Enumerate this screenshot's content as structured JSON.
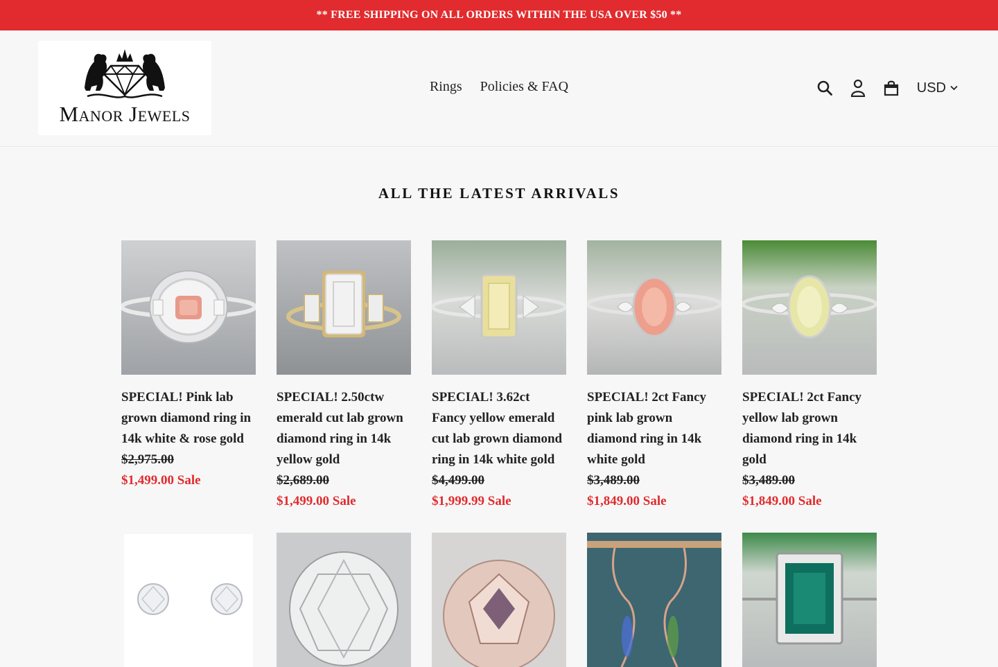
{
  "announcement": "** FREE SHIPPING ON ALL ORDERS WITHIN THE USA OVER $50 **",
  "logo": {
    "text": "Manor Jewels"
  },
  "nav": {
    "items": [
      "Rings",
      "Policies & FAQ"
    ]
  },
  "header_icons": [
    "search-icon",
    "account-icon",
    "cart-icon"
  ],
  "currency": {
    "selected": "USD"
  },
  "section_title": "ALL THE LATEST ARRIVALS",
  "colors": {
    "accent": "#e12b2e",
    "background": "#f7f7f7"
  },
  "products": [
    {
      "title": "SPECIAL! Pink lab grown diamond ring in 14k white & rose gold",
      "regular_price": "$2,975.00",
      "sale_price": "$1,499.00",
      "sale_label": "Sale",
      "image": "pink-cushion-halo-ring"
    },
    {
      "title": "SPECIAL! 2.50ctw emerald cut lab grown diamond ring in 14k yellow gold",
      "regular_price": "$2,689.00",
      "sale_price": "$1,499.00",
      "sale_label": "Sale",
      "image": "emerald-cut-yellow-gold-ring"
    },
    {
      "title": "SPECIAL! 3.62ct Fancy yellow emerald cut lab grown diamond ring in 14k white gold",
      "regular_price": "$4,499.00",
      "sale_price": "$1,999.99",
      "sale_label": "Sale",
      "image": "yellow-emerald-cut-ring"
    },
    {
      "title": "SPECIAL! 2ct Fancy pink lab grown diamond ring in 14k white gold",
      "regular_price": "$3,489.00",
      "sale_price": "$1,849.00",
      "sale_label": "Sale",
      "image": "pink-oval-ring"
    },
    {
      "title": "SPECIAL! 2ct Fancy yellow lab grown diamond ring in 14k gold",
      "regular_price": "$3,489.00",
      "sale_price": "$1,849.00",
      "sale_label": "Sale",
      "image": "yellow-oval-ring"
    },
    {
      "title": "",
      "regular_price": "",
      "sale_price": "",
      "sale_label": "",
      "image": "diamond-stud-earrings"
    },
    {
      "title": "",
      "regular_price": "",
      "sale_price": "",
      "sale_label": "",
      "image": "white-cushion-gem"
    },
    {
      "title": "",
      "regular_price": "",
      "sale_price": "",
      "sale_label": "",
      "image": "champagne-round-diamond"
    },
    {
      "title": "",
      "regular_price": "",
      "sale_price": "",
      "sale_label": "",
      "image": "opal-rose-gold-earrings"
    },
    {
      "title": "",
      "regular_price": "",
      "sale_price": "",
      "sale_label": "",
      "image": "emerald-halo-ring"
    }
  ]
}
